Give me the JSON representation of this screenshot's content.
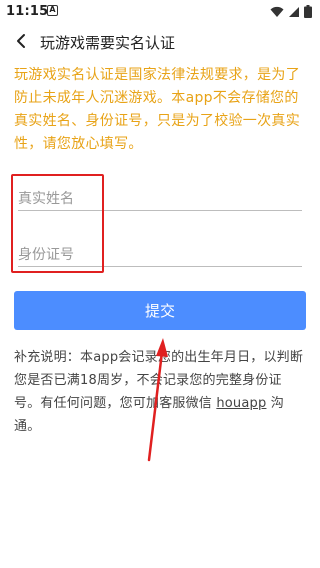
{
  "status_bar": {
    "time": "11:15",
    "notification_badge": "A",
    "icons": [
      "wifi-icon",
      "signal-icon",
      "battery-icon"
    ]
  },
  "header": {
    "back_icon": "chevron-left-icon",
    "title": "玩游戏需要实名认证"
  },
  "notice": {
    "text": "玩游戏实名认证是国家法律法规要求，是为了防止未成年人沉迷游戏。本app不会存储您的真实姓名、身份证号，只是为了校验一次真实性，请您放心填写。",
    "color": "#e8a317"
  },
  "form": {
    "name_placeholder": "真实姓名",
    "id_placeholder": "身份证号",
    "submit_label": "提交",
    "submit_color": "#4c8dff"
  },
  "footnote": {
    "prefix": "补充说明：本app会记录您的出生年月日，以判断您是否已满18周岁，不会记录您的完整身份证号。有任何问题，您可加客服微信 ",
    "wechat_id": "houapp",
    "suffix": " 沟通。"
  },
  "annotation": {
    "highlight_color": "#e02020"
  }
}
